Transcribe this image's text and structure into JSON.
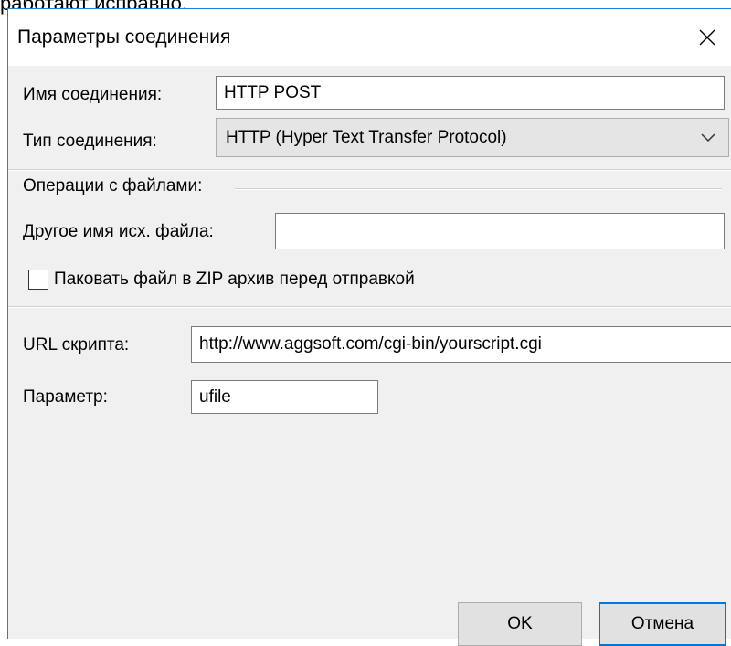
{
  "background_text": "работают исправно.",
  "dialog": {
    "title": "Параметры соединения",
    "close_icon": "close-icon"
  },
  "connection": {
    "name_label": "Имя соединения:",
    "name_value": "HTTP POST",
    "type_label": "Тип соединения:",
    "type_value": "HTTP (Hyper Text Transfer Protocol)"
  },
  "file_ops": {
    "group_label": "Операции с файлами:",
    "alt_name_label": "Другое имя исх. файла:",
    "alt_name_value": "",
    "zip_label": "Паковать файл в ZIP архив перед отправкой",
    "zip_checked": false
  },
  "script": {
    "url_label": "URL скрипта:",
    "url_value": "http://www.aggsoft.com/cgi-bin/yourscript.cgi",
    "param_label": "Параметр:",
    "param_value": "ufile"
  },
  "buttons": {
    "ok_label": "OK",
    "cancel_label": "Отмена"
  },
  "colors": {
    "accent": "#0078d7",
    "window_border": "#1883d7",
    "dialog_bg": "#f0f0f0"
  }
}
